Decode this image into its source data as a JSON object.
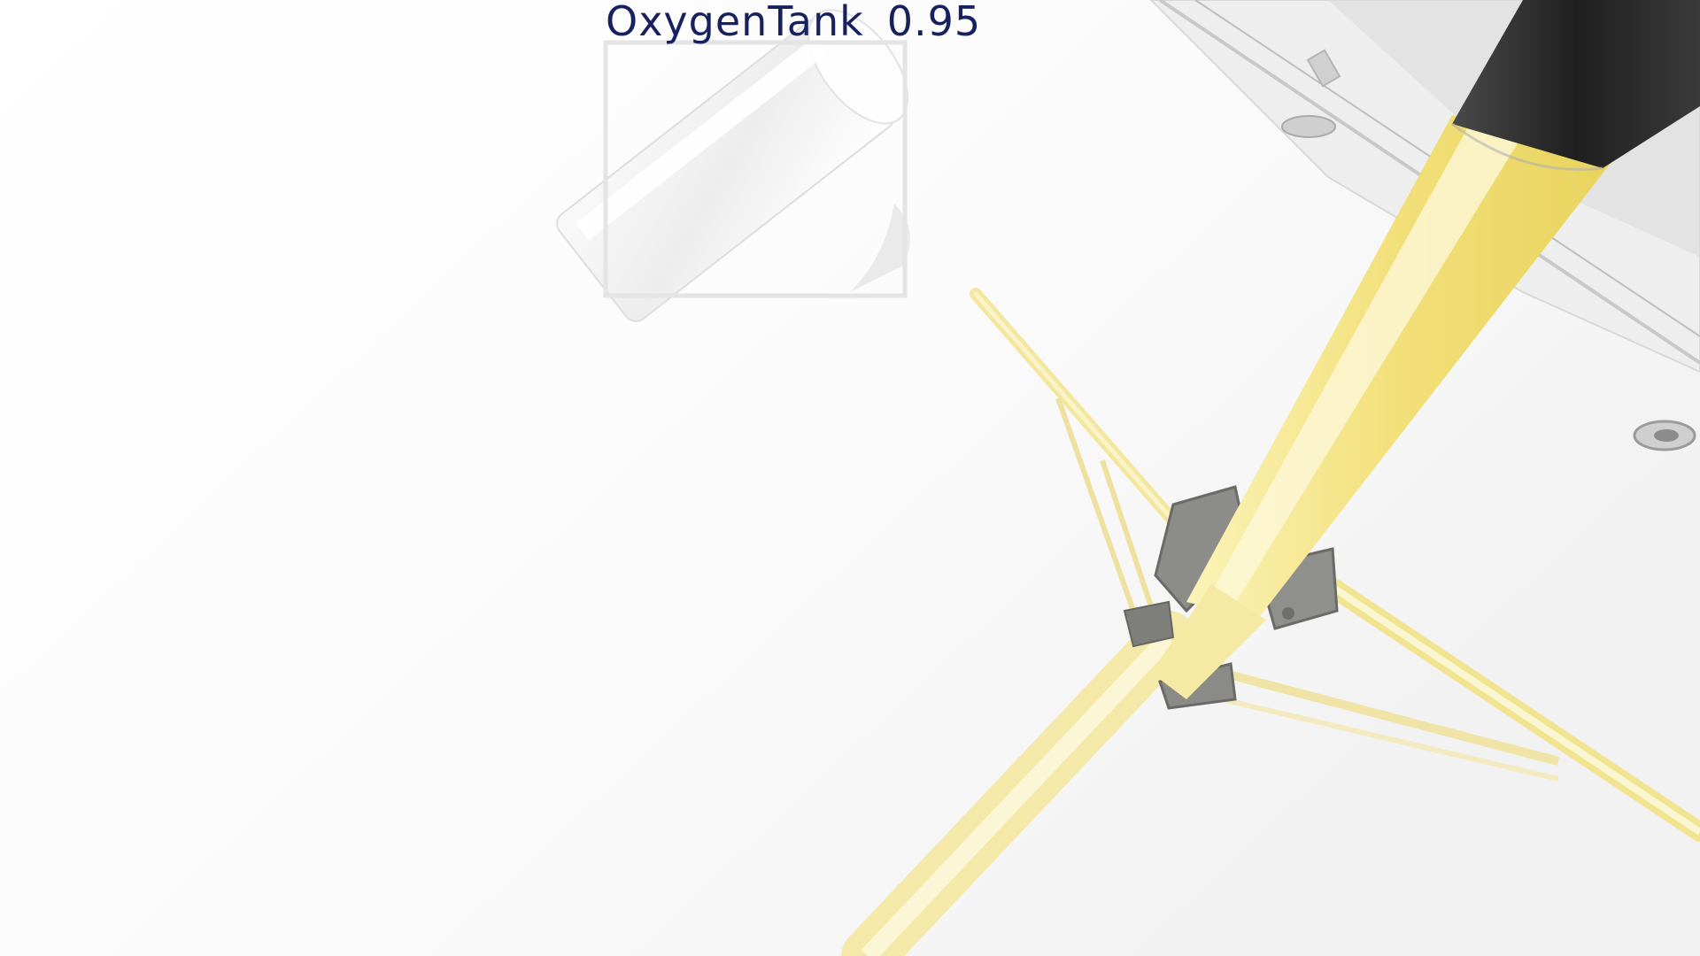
{
  "detections": [
    {
      "class_label": "OxygenTank",
      "confidence": "0.95"
    }
  ],
  "colors": {
    "label_text": "#17215e",
    "bbox_outline": "#e4e4e4",
    "scene_background": "#ffffff",
    "rod_yellow": "#f4eaa0",
    "metal_gray": "#8c8c88",
    "dark_cylinder": "#2b2b2b"
  }
}
